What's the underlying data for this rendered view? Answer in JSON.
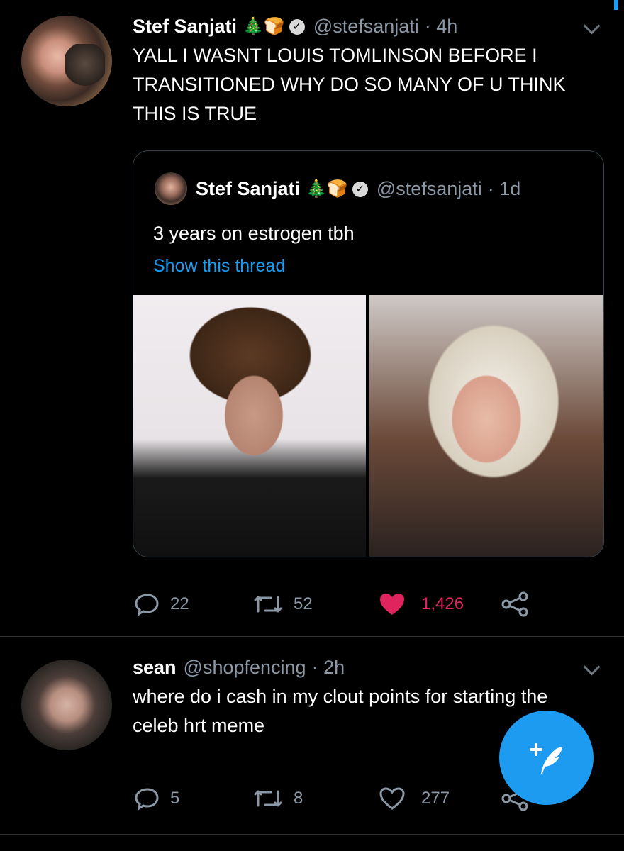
{
  "tweet1": {
    "name": "Stef Sanjati",
    "badges": "🎄🍞",
    "handle": "@stefsanjati",
    "time": "· 4h",
    "text": "YALL I WASNT LOUIS TOMLINSON BEFORE I TRANSITIONED WHY DO SO MANY OF U THINK THIS IS TRUE",
    "quote": {
      "name": "Stef Sanjati",
      "badges": "🎄🍞",
      "handle": "@stefsanjati",
      "time": "· 1d",
      "text": "3 years on estrogen tbh",
      "show_thread": "Show this thread"
    },
    "replies": "22",
    "retweets": "52",
    "likes": "1,426",
    "liked": true,
    "like_color": "#e0245e"
  },
  "tweet2": {
    "name": "sean",
    "handle": "@shopfencing",
    "time": "· 2h",
    "text": "where do i cash in my clout points for starting the celeb hrt meme",
    "replies": "5",
    "retweets": "8",
    "likes": "277"
  },
  "icons": {
    "reply": "reply-icon",
    "retweet": "retweet-icon",
    "like": "heart-icon",
    "share": "share-icon",
    "compose": "compose-tweet-icon",
    "verified": "verified-check-icon",
    "caret": "chevron-down-icon"
  },
  "colors": {
    "accent": "#1d9bf0",
    "background": "#000000",
    "secondary_text": "#8b98a5"
  }
}
